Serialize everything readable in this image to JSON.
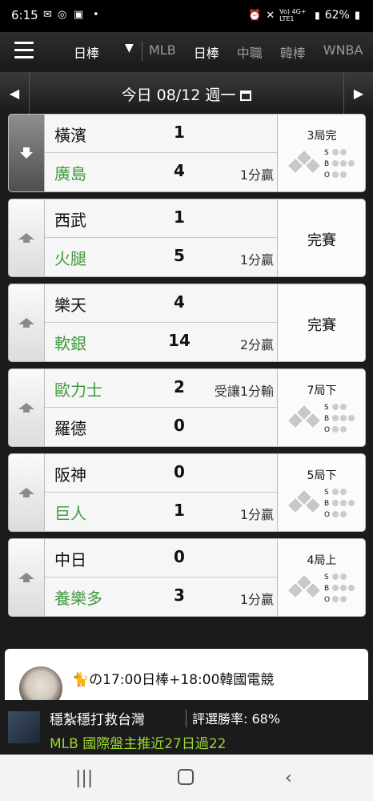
{
  "status": {
    "time": "6:15",
    "battery": "62%",
    "signal_text": "Vo) 4G+ LTE1"
  },
  "nav": {
    "league_select": "日棒",
    "tabs": [
      "MLB",
      "日棒",
      "中職",
      "韓棒",
      "WNBA"
    ],
    "active_tab": "日棒"
  },
  "datebar": {
    "date_text": "今日 08/12 週一"
  },
  "games": [
    {
      "away": "橫濱",
      "away_score": "1",
      "away_note": "",
      "home": "廣島",
      "home_score": "4",
      "home_note": "1分贏",
      "winner": "home",
      "status": "3局完",
      "live": true
    },
    {
      "away": "西武",
      "away_score": "1",
      "away_note": "",
      "home": "火腿",
      "home_score": "5",
      "home_note": "1分贏",
      "winner": "home",
      "status": "完賽",
      "live": false
    },
    {
      "away": "樂天",
      "away_score": "4",
      "away_note": "",
      "home": "軟銀",
      "home_score": "14",
      "home_note": "2分贏",
      "winner": "home",
      "status": "完賽",
      "live": false
    },
    {
      "away": "歐力士",
      "away_score": "2",
      "away_note": "受讓1分輸",
      "home": "羅德",
      "home_score": "0",
      "home_note": "",
      "winner": "away",
      "status": "7局下",
      "live": true
    },
    {
      "away": "阪神",
      "away_score": "0",
      "away_note": "",
      "home": "巨人",
      "home_score": "1",
      "home_note": "1分贏",
      "winner": "home",
      "status": "5局下",
      "live": true
    },
    {
      "away": "中日",
      "away_score": "0",
      "away_note": "",
      "home": "養樂多",
      "home_score": "3",
      "home_note": "1分贏",
      "winner": "home",
      "status": "4局上",
      "live": true
    }
  ],
  "sbo_labels": [
    "S",
    "B",
    "O"
  ],
  "promo": {
    "cat_icon": "cat-emoji-icon",
    "text": "の17:00日棒+18:00韓國電競"
  },
  "ticker": {
    "name": "穩紮穩打救台灣",
    "rate_label": "評選勝率: 68%",
    "headline": "MLB 國際盤主推近27日過22"
  },
  "colors": {
    "winner_green": "#3f9a3f",
    "ticker_green": "#9ad630",
    "background": "#1b1b1b"
  }
}
